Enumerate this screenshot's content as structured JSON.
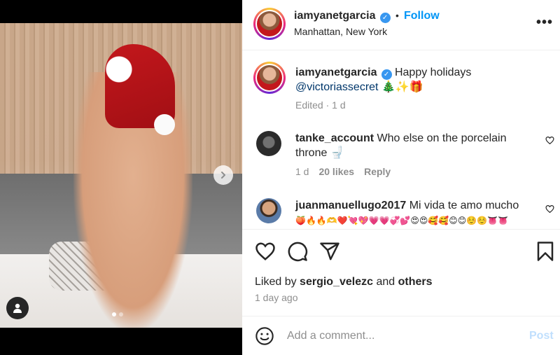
{
  "post": {
    "author": "iamyanetgarcia",
    "verified": true,
    "follow_label": "Follow",
    "bullet": "•",
    "location": "Manhattan, New York",
    "more_label": "•••"
  },
  "caption": {
    "username": "iamyanetgarcia",
    "text": "Happy holidays",
    "mention": "@victoriassecret",
    "emojis": "🎄✨🎁",
    "meta": "Edited · 1 d"
  },
  "comments": [
    {
      "username": "tanke_account",
      "text": "Who else on the porcelain throne 🚽",
      "time": "1 d",
      "likes": "20 likes",
      "reply_label": "Reply"
    },
    {
      "username": "juanmanuellugo2017",
      "text": "Mi vida te amo mucho",
      "emoji_line": "🍑🔥🔥🫶❤️💘💖💗💗💞💕😍😍🥰🥰😊😊☺️☺️👅👅"
    }
  ],
  "engagement": {
    "liked_by_prefix": "Liked by",
    "liked_by_user": "sergio_velezc",
    "liked_by_and": "and",
    "liked_by_others": "others",
    "age": "1 day ago"
  },
  "composer": {
    "placeholder": "Add a comment...",
    "post_label": "Post"
  },
  "icons": {
    "next": "chevron-right-icon",
    "user_tag": "user-icon",
    "like": "heart-icon",
    "comment": "comment-icon",
    "share": "paper-plane-icon",
    "save": "bookmark-icon",
    "emoji": "emoji-icon"
  },
  "colors": {
    "accent": "#0095f6",
    "verified": "#3897f0",
    "post_disabled": "#c0dffd",
    "mention": "#00376b"
  }
}
